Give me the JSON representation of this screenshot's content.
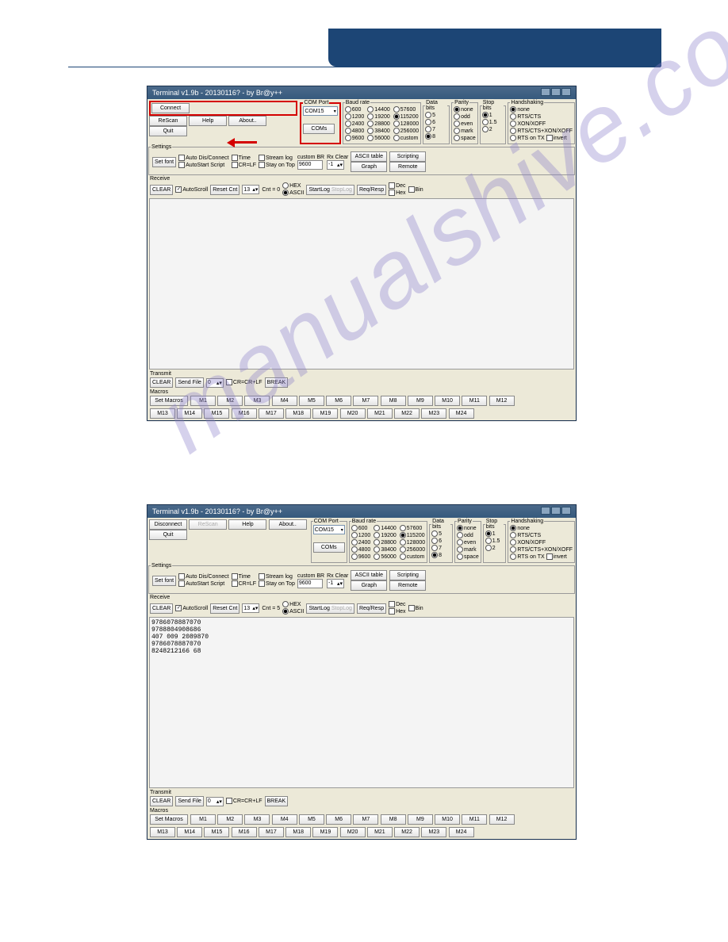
{
  "watermark": "manualshive.com",
  "app1": {
    "title": "Terminal v1.9b - 20130116? - by Br@y++",
    "left_buttons": {
      "connect": "Connect",
      "rescan": "ReScan",
      "help": "Help",
      "about": "About..",
      "quit": "Quit"
    },
    "com": {
      "label": "COM Port",
      "selected": "COM15",
      "coms_btn": "COMs"
    },
    "baud": {
      "label": "Baud rate",
      "options": [
        "600",
        "1200",
        "2400",
        "4800",
        "9600",
        "14400",
        "19200",
        "28800",
        "38400",
        "56000",
        "57600",
        "115200",
        "128000",
        "256000",
        "custom"
      ],
      "selected": "9600",
      "highlight": "115200"
    },
    "databits": {
      "label": "Data bits",
      "options": [
        "5",
        "6",
        "7",
        "8"
      ],
      "selected": "8"
    },
    "parity": {
      "label": "Parity",
      "options": [
        "none",
        "odd",
        "even",
        "mark",
        "space"
      ],
      "selected": "none"
    },
    "stopbits": {
      "label": "Stop bits",
      "options": [
        "1",
        "1.5",
        "2"
      ],
      "selected": "1"
    },
    "handshaking": {
      "label": "Handshaking",
      "options": [
        "none",
        "RTS/CTS",
        "XON/XOFF",
        "RTS/CTS+XON/XOFF",
        "RTS on TX"
      ],
      "selected": "none",
      "invert": "invert"
    },
    "settings": {
      "label": "Settings",
      "setfont": "Set font",
      "auto_dis": "Auto Dis/Connect",
      "autostart": "AutoStart Script",
      "time": "Time",
      "crlf": "CR=LF",
      "stream": "Stream log",
      "stay": "Stay on Top",
      "custombr_lbl": "custom BR",
      "custombr": "9600",
      "rxclear": "Rx Clear",
      "rxval": "-1",
      "ascii_btn": "ASCII table",
      "graph": "Graph",
      "scripting": "Scripting",
      "remote": "Remote"
    },
    "receive": {
      "label": "Receive",
      "clear": "CLEAR",
      "autoscroll": "AutoScroll",
      "reset": "Reset Cnt",
      "cnt_val": "13",
      "cnt_label": "Cnt = 0",
      "hex": "HEX",
      "ascii": "ASCII",
      "startlog": "StartLog",
      "stoplog": "StopLog",
      "reqresp": "Req/Resp",
      "dec": "Dec",
      "bin": "Bin",
      "hexchk": "Hex"
    },
    "transmit": {
      "label": "Transmit",
      "clear": "CLEAR",
      "sendfile": "Send File",
      "val": "0",
      "crcrlf": "CR=CR+LF",
      "break": "BREAK"
    },
    "macros": {
      "label": "Macros",
      "set": "Set Macros",
      "m": [
        "M1",
        "M2",
        "M3",
        "M4",
        "M5",
        "M6",
        "M7",
        "M8",
        "M9",
        "M10",
        "M11",
        "M12",
        "M13",
        "M14",
        "M15",
        "M16",
        "M17",
        "M18",
        "M19",
        "M20",
        "M21",
        "M22",
        "M23",
        "M24"
      ]
    }
  },
  "app2": {
    "title": "Terminal v1.9b - 20130116? - by Br@y++",
    "left_buttons": {
      "disconnect": "Disconnect",
      "rescan": "ReScan",
      "help": "Help",
      "about": "About..",
      "quit": "Quit"
    },
    "com": {
      "label": "COM Port",
      "selected": "COM15",
      "coms_btn": "COMs"
    },
    "baud": {
      "label": "Baud rate",
      "options": [
        "600",
        "1200",
        "2400",
        "4800",
        "9600",
        "14400",
        "19200",
        "28800",
        "38400",
        "56000",
        "57600",
        "115200",
        "128000",
        "256000",
        "custom"
      ],
      "selected": "115200"
    },
    "databits": {
      "label": "Data bits",
      "options": [
        "5",
        "6",
        "7",
        "8"
      ],
      "selected": "8"
    },
    "parity": {
      "label": "Parity",
      "options": [
        "none",
        "odd",
        "even",
        "mark",
        "space"
      ],
      "selected": "none"
    },
    "stopbits": {
      "label": "Stop bits",
      "options": [
        "1",
        "1.5",
        "2"
      ],
      "selected": "1"
    },
    "handshaking": {
      "label": "Handshaking",
      "options": [
        "none",
        "RTS/CTS",
        "XON/XOFF",
        "RTS/CTS+XON/XOFF",
        "RTS on TX"
      ],
      "selected": "none",
      "invert": "invert"
    },
    "settings": {
      "label": "Settings",
      "setfont": "Set font",
      "auto_dis": "Auto Dis/Connect",
      "autostart": "AutoStart Script",
      "time": "Time",
      "crlf": "CR=LF",
      "stream": "Stream log",
      "stay": "Stay on Top",
      "custombr_lbl": "custom BR",
      "custombr": "9600",
      "rxclear": "Rx Clear",
      "rxval": "-1",
      "ascii_btn": "ASCII table",
      "graph": "Graph",
      "scripting": "Scripting",
      "remote": "Remote"
    },
    "receive": {
      "label": "Receive",
      "clear": "CLEAR",
      "autoscroll": "AutoScroll",
      "reset": "Reset Cnt",
      "cnt_val": "13",
      "cnt_label": "Cnt = 5",
      "hex": "HEX",
      "ascii": "ASCII",
      "startlog": "StartLog",
      "stoplog": "StopLog",
      "reqresp": "Req/Resp",
      "dec": "Dec",
      "bin": "Bin",
      "hexchk": "Hex",
      "data": "9786078887070\n9788804908686\n407 009 2089870\n9786078887070\n8248212166 68"
    },
    "transmit": {
      "label": "Transmit",
      "clear": "CLEAR",
      "sendfile": "Send File",
      "val": "0",
      "crcrlf": "CR=CR+LF",
      "break": "BREAK"
    },
    "macros": {
      "label": "Macros",
      "set": "Set Macros",
      "m": [
        "M1",
        "M2",
        "M3",
        "M4",
        "M5",
        "M6",
        "M7",
        "M8",
        "M9",
        "M10",
        "M11",
        "M12",
        "M13",
        "M14",
        "M15",
        "M16",
        "M17",
        "M18",
        "M19",
        "M20",
        "M21",
        "M22",
        "M23",
        "M24"
      ]
    }
  }
}
